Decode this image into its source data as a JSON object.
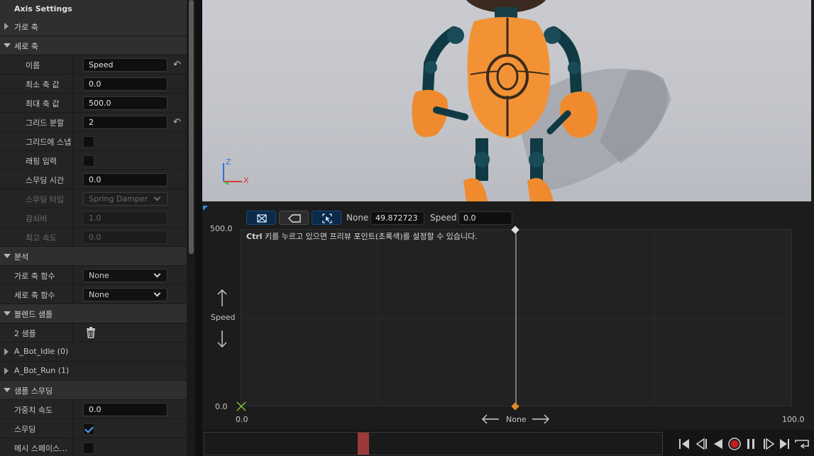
{
  "details": {
    "axis_settings": "Axis Settings",
    "horizontal_axis": "가로 축",
    "vertical_axis": "세로 축",
    "name_label": "이름",
    "name_value": "Speed",
    "min_label": "최소 축 값",
    "min_value": "0.0",
    "max_label": "최대 축 값",
    "max_value": "500.0",
    "grid_label": "그리드 분할",
    "grid_value": "2",
    "snap_label": "그리드에 스냅",
    "wrap_label": "래핑 입력",
    "smooth_time_label": "스무딩 시간",
    "smooth_time_value": "0.0",
    "smooth_type_label": "스무딩 타입",
    "smooth_type_value": "Spring Damper",
    "damping_label": "감쇠비",
    "damping_value": "1.0",
    "maxspeed_label": "최고 속도",
    "maxspeed_value": "0.0",
    "analysis": "분석",
    "h_func_label": "가로 축 함수",
    "h_func_value": "None",
    "v_func_label": "세로 축 함수",
    "v_func_value": "None",
    "blend_samples": "블렌드 샘플",
    "samples_count": "2 샘플",
    "sample1": "A_Bot_Idle (0)",
    "sample2": "A_Bot_Run (1)",
    "sample_smoothing": "샘플 스무딩",
    "weight_speed_label": "가중치 속도",
    "weight_speed_value": "0.0",
    "smoothing_label": "스무딩",
    "smoothing_checked": true,
    "mesh_space_label": "메시 스페이스..."
  },
  "viewport": {
    "gizmo_z": "Z",
    "gizmo_x": "X"
  },
  "graph": {
    "h_name": "None",
    "h_value": "49.872723",
    "v_name": "Speed",
    "v_value": "0.0",
    "y_max": "500.0",
    "y_min": "0.0",
    "x_min": "0.0",
    "x_max": "100.0",
    "y_axis_label": "Speed",
    "x_axis_label": "None",
    "hint_bold": "Ctrl",
    "hint_rest": " 키를 누르고 있으면 프리뷰 포인트(초록색)를 설정할 수 있습니다."
  },
  "colors": {
    "sample_point": "#e08a2a",
    "preview_point": "#7fc23a",
    "accent_blue": "#1b4a77",
    "playhead": "#9b3a3a"
  }
}
